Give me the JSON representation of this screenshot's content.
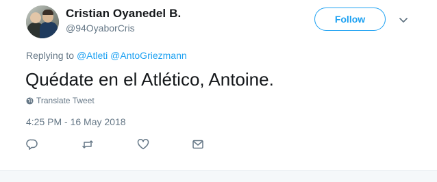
{
  "author": {
    "display_name": "Cristian Oyanedel B.",
    "handle": "@94OyaborCris"
  },
  "follow": {
    "label": "Follow"
  },
  "reply": {
    "prefix": "Replying to",
    "mentions": [
      "@Atleti",
      "@AntoGriezmann"
    ]
  },
  "tweet": {
    "text": "Quédate en el Atlético, Antoine.",
    "translate_label": "Translate Tweet",
    "timestamp": "4:25 PM - 16 May 2018"
  },
  "actions": {
    "icons": [
      "reply-icon",
      "retweet-icon",
      "like-icon",
      "direct-message-icon"
    ]
  },
  "colors": {
    "accent": "#1da1f2",
    "muted": "#657786",
    "text": "#14171a"
  }
}
